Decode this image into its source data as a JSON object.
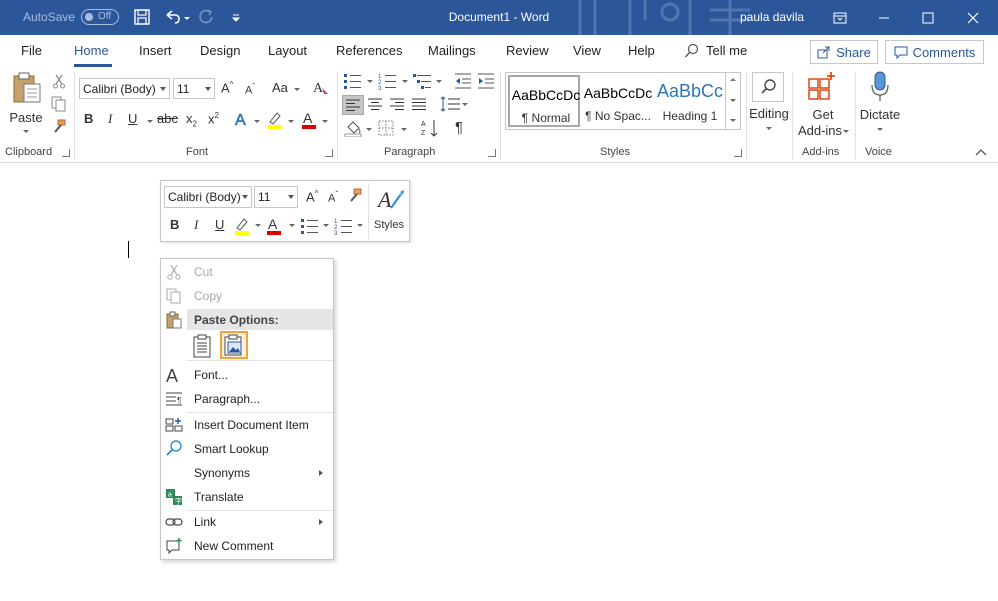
{
  "titlebar": {
    "autosave_label": "AutoSave",
    "autosave_state": "Off",
    "doc_title": "Document1  -  Word",
    "user_name": "paula davila"
  },
  "tabs": [
    {
      "label": "File"
    },
    {
      "label": "Home"
    },
    {
      "label": "Insert"
    },
    {
      "label": "Design"
    },
    {
      "label": "Layout"
    },
    {
      "label": "References"
    },
    {
      "label": "Mailings"
    },
    {
      "label": "Review"
    },
    {
      "label": "View"
    },
    {
      "label": "Help"
    }
  ],
  "tell_me": "Tell me",
  "share_label": "Share",
  "comments_label": "Comments",
  "ribbon": {
    "clipboard": {
      "paste_label": "Paste",
      "group_label": "Clipboard"
    },
    "font": {
      "font_name": "Calibri (Body)",
      "font_size": "11",
      "group_label": "Font",
      "change_case": "Aa"
    },
    "paragraph": {
      "group_label": "Paragraph"
    },
    "styles": {
      "group_label": "Styles",
      "items": [
        {
          "sample": "AaBbCcDc",
          "name": "¶ Normal"
        },
        {
          "sample": "AaBbCcDc",
          "name": "¶ No Spac..."
        },
        {
          "sample": "AaBbCc",
          "name": "Heading 1"
        }
      ]
    },
    "editing_label": "Editing",
    "addins": {
      "label_line1": "Get",
      "label_line2": "Add-ins",
      "group_label": "Add-ins"
    },
    "voice": {
      "dictate_label": "Dictate",
      "group_label": "Voice"
    }
  },
  "mini_toolbar": {
    "font_name": "Calibri (Body)",
    "font_size": "11",
    "styles_label": "Styles"
  },
  "context_menu": {
    "cut": "Cut",
    "copy": "Copy",
    "paste_options": "Paste Options:",
    "font": "Font...",
    "paragraph": "Paragraph...",
    "insert_doc_item": "Insert Document Item",
    "smart_lookup": "Smart Lookup",
    "synonyms": "Synonyms",
    "translate": "Translate",
    "link": "Link",
    "new_comment": "New Comment"
  },
  "colors": {
    "word_blue": "#2b579a",
    "highlight_yellow": "#ffff00",
    "font_red": "#e00000",
    "accent_orange": "#f4a13a"
  }
}
